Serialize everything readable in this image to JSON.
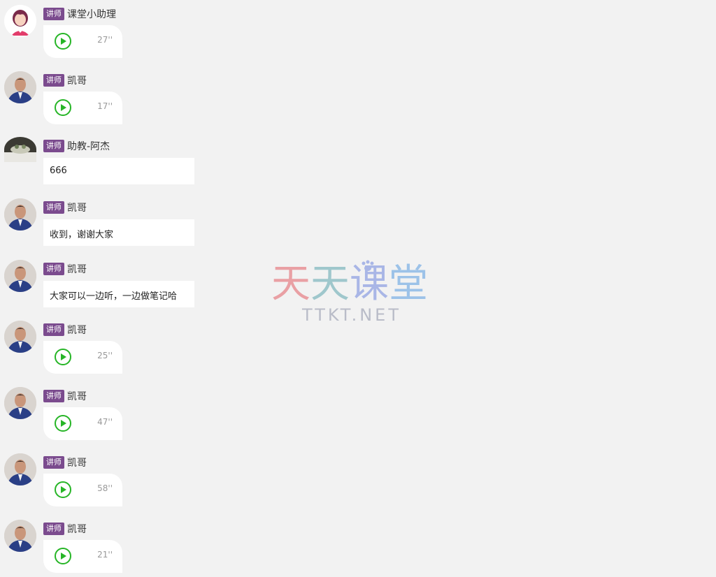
{
  "badge_label": "讲师",
  "messages": [
    {
      "name": "课堂小助理",
      "type": "voice",
      "duration": "27''",
      "avatar": "assistant-avatar"
    },
    {
      "name": "凯哥",
      "type": "voice",
      "duration": "17''",
      "avatar": "kaige-avatar"
    },
    {
      "name": "助教-阿杰",
      "type": "text",
      "text": "666",
      "avatar": "ajie-avatar"
    },
    {
      "name": "凯哥",
      "type": "text",
      "text": "收到，谢谢大家",
      "avatar": "kaige-avatar"
    },
    {
      "name": "凯哥",
      "type": "text",
      "text": "大家可以一边听，一边做笔记哈",
      "avatar": "kaige-avatar"
    },
    {
      "name": "凯哥",
      "type": "voice",
      "duration": "25''",
      "avatar": "kaige-avatar"
    },
    {
      "name": "凯哥",
      "type": "voice",
      "duration": "47''",
      "avatar": "kaige-avatar"
    },
    {
      "name": "凯哥",
      "type": "voice",
      "duration": "58''",
      "avatar": "kaige-avatar"
    },
    {
      "name": "凯哥",
      "type": "voice",
      "duration": "21''",
      "avatar": "kaige-avatar"
    }
  ],
  "watermark": {
    "chars": [
      "天",
      "天",
      "课",
      "堂"
    ],
    "subtitle": "TTKT.NET"
  },
  "colors": {
    "background": "#f2f2f2",
    "badge": "#7b4b8e",
    "play": "#26b526"
  }
}
